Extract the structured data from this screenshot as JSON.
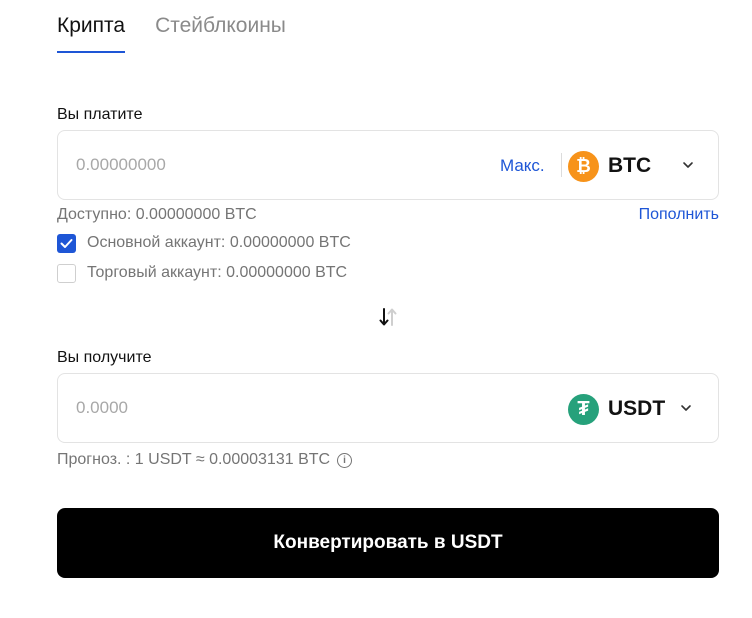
{
  "tabs": [
    {
      "label": "Крипта"
    },
    {
      "label": "Стейблкоины"
    }
  ],
  "pay": {
    "label": "Вы платите",
    "placeholder": "0.00000000",
    "max_label": "Макс.",
    "coin": "BTC",
    "coin_glyph": "₿",
    "available": "Доступно: 0.00000000 BTC",
    "topup_label": "Пополнить"
  },
  "accounts": [
    {
      "label": "Основной аккаунт: 0.00000000 BTC",
      "checked": true
    },
    {
      "label": "Торговый аккаунт: 0.00000000 BTC",
      "checked": false
    }
  ],
  "receive": {
    "label": "Вы получите",
    "placeholder": "0.0000",
    "coin": "USDT",
    "coin_glyph": "₮"
  },
  "forecast": {
    "text": "Прогноз. : 1 USDT ≈ 0.00003131 BTC",
    "info_glyph": "i"
  },
  "convert_button": "Конвертировать в USDT",
  "colors": {
    "accent": "#1e56d6",
    "btc": "#f7931a",
    "usdt": "#26a17b",
    "button": "#000000"
  },
  "icons": [
    "btc-icon",
    "usdt-icon",
    "chevron-down-icon",
    "swap-arrows-icon",
    "info-icon",
    "check-icon"
  ]
}
